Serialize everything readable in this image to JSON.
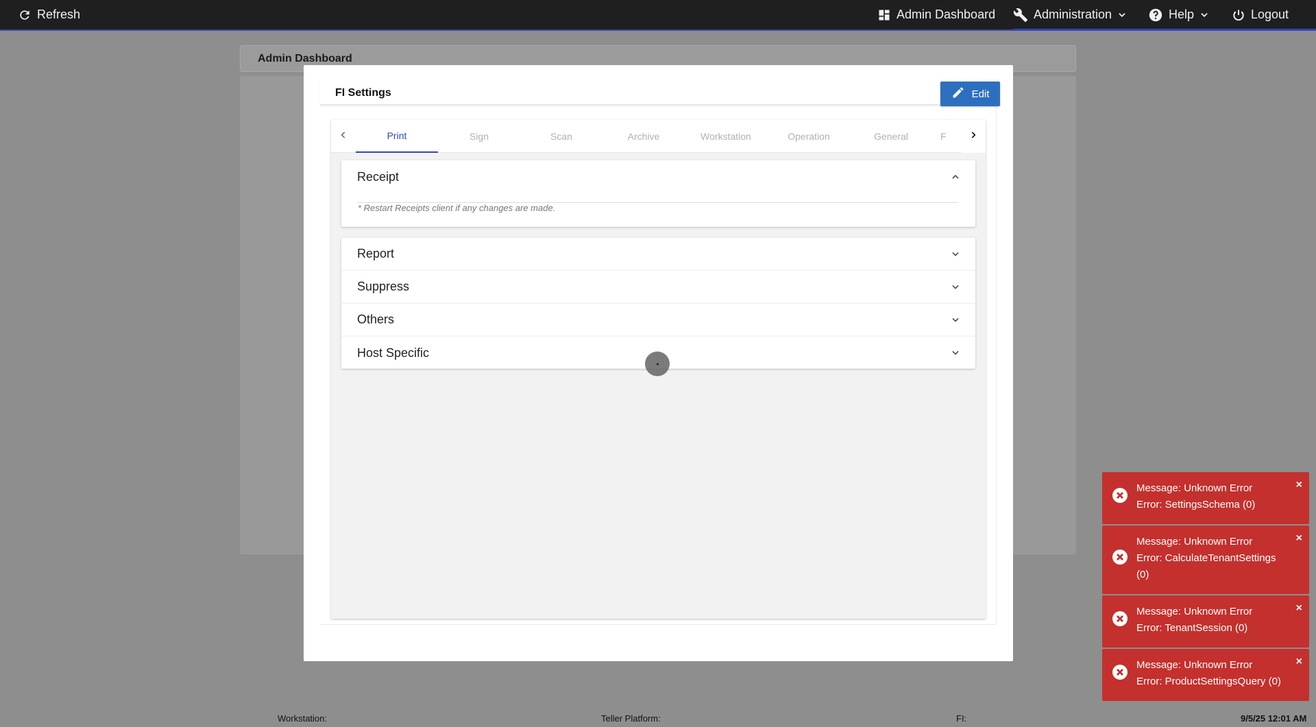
{
  "topbar": {
    "refresh_label": "Refresh",
    "admin_dashboard_label": "Admin Dashboard",
    "administration_label": "Administration",
    "help_label": "Help",
    "logout_label": "Logout"
  },
  "background_page": {
    "header_title": "Admin Dashboard"
  },
  "modal": {
    "title": "FI Settings",
    "edit_label": "Edit",
    "tabs": [
      {
        "label": "Print",
        "active": true
      },
      {
        "label": "Sign"
      },
      {
        "label": "Scan"
      },
      {
        "label": "Archive"
      },
      {
        "label": "Workstation"
      },
      {
        "label": "Operation"
      },
      {
        "label": "General"
      },
      {
        "label": "F"
      }
    ],
    "receipt": {
      "title": "Receipt",
      "note": "* Restart Receipts client if any changes are made."
    },
    "sections": [
      {
        "title": "Report"
      },
      {
        "title": "Suppress"
      },
      {
        "title": "Others"
      },
      {
        "title": "Host Specific"
      }
    ]
  },
  "statusbar": {
    "workstation_label": "Workstation:",
    "teller_platform_label": "Teller Platform:",
    "fi_label": "FI:",
    "datetime": "9/5/25 12:01 AM"
  },
  "toasts": [
    {
      "line1": "Message: Unknown Error",
      "line2": "Error: SettingsSchema (0)"
    },
    {
      "line1": "Message: Unknown Error",
      "line2": "Error: CalculateTenantSettings (0)"
    },
    {
      "line1": "Message: Unknown Error",
      "line2": "Error: TenantSession (0)"
    },
    {
      "line1": "Message: Unknown Error",
      "line2": "Error: ProductSettingsQuery (0)"
    }
  ],
  "toast_close_glyph": "×",
  "colors": {
    "topbar_bg": "#1f1f1f",
    "accent_blue": "#2d6fbf",
    "tab_active": "#3048b0",
    "toast_red": "#c4302d"
  }
}
